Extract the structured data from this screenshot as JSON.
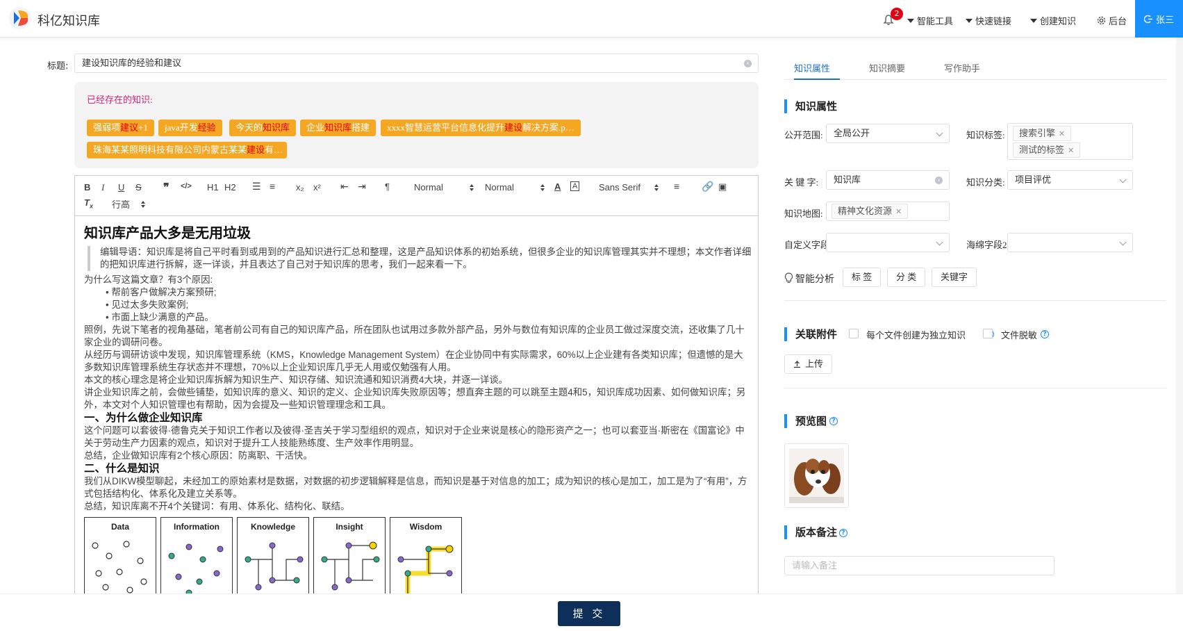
{
  "app": {
    "brand": "科亿知识库"
  },
  "header": {
    "notifications": "2",
    "nav": [
      "智能工具",
      "快速链接",
      "创建知识"
    ],
    "admin": "后台",
    "user": "张三"
  },
  "form": {
    "title_label": "标题:",
    "title_value": "建设知识库的经验和建议",
    "existing_label": "已经存在的知识:",
    "existing": [
      {
        "pre": "强弱项",
        "hl": "建议",
        "post": "+1"
      },
      {
        "pre": "java开发",
        "hl": "经验",
        "post": ""
      },
      {
        "pre": "今天的",
        "hl": "知识库",
        "post": ""
      },
      {
        "pre": "企业",
        "hl": "知识库",
        "post": "搭建"
      },
      {
        "pre": "xxxx智慧运营平台信息化提升",
        "hl": "建设",
        "post": "解决方案.p…"
      },
      {
        "pre": "珠海某某照明科技有限公司内蒙古某某",
        "hl": "建设",
        "post": "有…"
      }
    ]
  },
  "toolbar": {
    "header_select": "Normal",
    "size_select": "Normal",
    "font_select": "Sans Serif",
    "line_height": "行高",
    "h1": "H1",
    "h2": "H2",
    "sub": "x₂",
    "sup": "x²"
  },
  "article": {
    "h1": "知识库产品大多是无用垃圾",
    "quote": "编辑导语：知识库是将自己平时看到或用到的产品知识进行汇总和整理，这是产品知识体系的初始系统，但很多企业的知识库管理其实并不理想；本文作者详细的把知识库进行拆解，逐一详谈，并且表达了自己对于知识库的思考，我们一起来看一下。",
    "p1": "为什么写这篇文章？有3个原因:",
    "list": [
      "帮前客户做解决方案预研;",
      "见过太多失败案例;",
      "市面上缺少满意的产品。"
    ],
    "p2": "照例，先说下笔者的视角基础，笔者前公司有自己的知识库产品，所在团队也试用过多款外部产品，另外与数位有知识库的企业员工做过深度交流，还收集了几十家企业的调研问卷。",
    "p3": "从经历与调研访谈中发现，知识库管理系统（KMS，Knowledge Management System）在企业协同中有实际需求，60%以上企业建有各类知识库；但遗憾的是大多数知识库管理系统生存状态并不理想，70%以上企业知识库几乎无人用或仅勉强有人用。",
    "p4": "本文的核心理念是将企业知识库拆解为知识生产、知识存储、知识流通和知识消费4大块，并逐一详谈。",
    "p5": "讲企业知识库之前，会做些铺垫，如知识库的意义、知识的定义、企业知识库失败原因等；想直奔主题的可以跳至主题4和5，知识库成功因素、如何做知识库；另外，本文对个人知识管理也有帮助，因为会提及一些知识管理理念和工具。",
    "h2a": "一、为什么做企业知识库",
    "p6": "这个问题可以套彼得·德鲁克关于知识工作者以及彼得·圣吉关于学习型组织的观点，知识对于企业来说是核心的隐形资产之一；也可以套亚当·斯密在《国富论》中关于劳动生产力因素的观点，知识对于提升工人技能熟练度、生产效率作用明显。",
    "p7": "总结，企业做知识库有2个核心原因：防离职、干活快。",
    "h2b": "二、什么是知识",
    "p8": "我们从DIKW模型聊起，未经加工的原始素材是数据，对数据的初步逻辑解释是信息，而知识是基于对信息的加工；成为知识的核心是加工，加工是为了“有用”，方式包括结构化、体系化及建立关系等。",
    "p9": "总结，知识库离不开4个关键词：有用、体系化、结构化、联结。",
    "dikw": [
      "Data",
      "Information",
      "Knowledge",
      "Insight",
      "Wisdom"
    ]
  },
  "footer": {
    "submit": "提 交"
  },
  "side": {
    "tabs": [
      "知识属性",
      "知识摘要",
      "写作助手"
    ],
    "sec_props": "知识属性",
    "scope_label": "公开范围:",
    "scope_value": "全局公开",
    "tags_label": "知识标签:",
    "tags": [
      "搜索引擎",
      "测试的标签"
    ],
    "keyword_label": "关 键 字:",
    "keyword_value": "知识库",
    "category_label": "知识分类:",
    "category_value": "项目评优",
    "map_label": "知识地图:",
    "map_value": "精神文化资源",
    "custom1_label": "自定义字段",
    "custom2_label": "海绵字段2",
    "ai_label": "智能分析",
    "ai_buttons": [
      "标 签",
      "分 类",
      "关键字"
    ],
    "sec_attach": "关联附件",
    "opt1": "每个文件创建为独立知识",
    "opt2": "文件脱敏",
    "upload": "上传",
    "sec_preview": "预览图",
    "sec_version": "版本备注",
    "note_placeholder": "请输入备注"
  }
}
